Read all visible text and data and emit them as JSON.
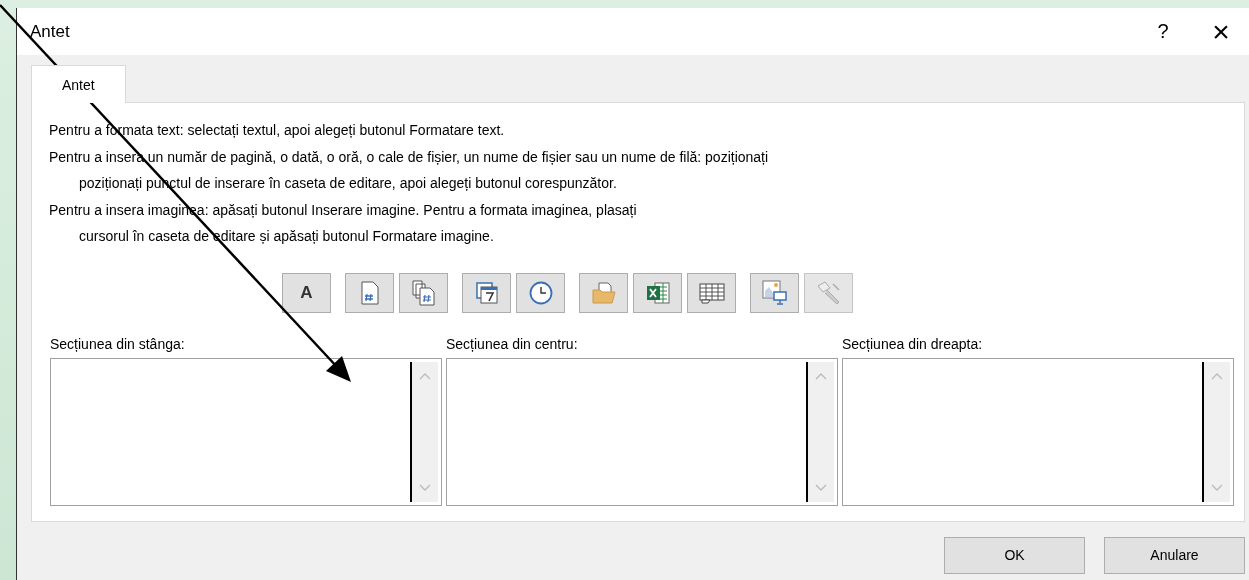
{
  "window": {
    "title": "Antet"
  },
  "title_buttons": [
    "?",
    "×"
  ],
  "tabs": [
    {
      "label": "Antet",
      "selected": true
    }
  ],
  "instructions": [
    {
      "text": "Pentru a formata text: selectați textul, apoi alegeți butonul Formatare text.",
      "indented": false
    },
    {
      "text": "Pentru a insera un număr de pagină, o dată, o oră, o cale de fișier, un nume de fișier sau un nume de filă: poziționați",
      "indented": false
    },
    {
      "text": "poziționați punctul de inserare în caseta de editare, apoi alegeți butonul corespunzător.",
      "indented": true
    },
    {
      "text": "Pentru a insera imaginea: apăsați butonul Inserare imagine. Pentru a formata imaginea, plasați",
      "indented": false
    },
    {
      "text": "cursorul în caseta de editare și apăsați butonul Formatare imagine.",
      "indented": true
    }
  ],
  "toolbar": [
    [
      {
        "kind": "format-text",
        "label": "A",
        "disabled": false
      }
    ],
    [
      {
        "kind": "page-number",
        "disabled": false
      },
      {
        "kind": "page-count",
        "disabled": false
      }
    ],
    [
      {
        "kind": "date",
        "disabled": false
      },
      {
        "kind": "time",
        "disabled": false
      }
    ],
    [
      {
        "kind": "file-path",
        "disabled": false
      },
      {
        "kind": "file-name",
        "disabled": false
      },
      {
        "kind": "sheet-name",
        "disabled": false
      }
    ],
    [
      {
        "kind": "insert-picture",
        "disabled": false
      },
      {
        "kind": "format-picture",
        "disabled": true
      }
    ]
  ],
  "sections": [
    {
      "label": "Secțiunea din stânga:"
    },
    {
      "label": "Secțiunea din centru:"
    },
    {
      "label": "Secțiunea din dreapta:"
    }
  ],
  "buttons": [
    "OK",
    "Anulare"
  ]
}
